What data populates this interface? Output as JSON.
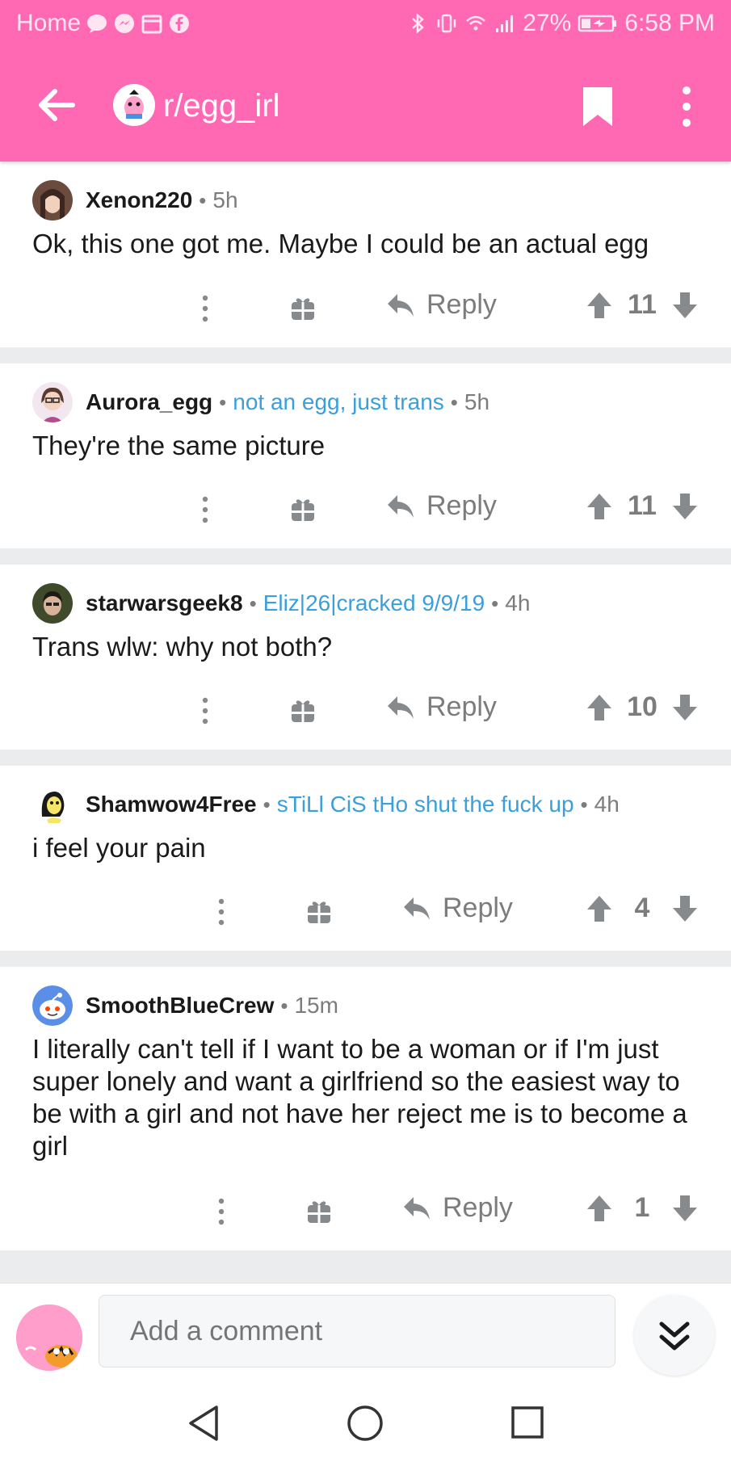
{
  "status_bar": {
    "left_label": "Home",
    "battery": "27%",
    "time": "6:58 PM"
  },
  "header": {
    "subreddit": "r/egg_irl",
    "accent_color": "#ff69b4"
  },
  "comments": [
    {
      "author": "Xenon220",
      "flair": "",
      "age": "5h",
      "body": "Ok, this one got me. Maybe I could be an actual egg",
      "reply_label": "Reply",
      "score": "11"
    },
    {
      "author": "Aurora_egg",
      "flair": "not an egg, just trans",
      "age": "5h",
      "body": "They're the same picture",
      "reply_label": "Reply",
      "score": "11"
    },
    {
      "author": "starwarsgeek8",
      "flair": "Eliz|26|cracked 9/9/19",
      "age": "4h",
      "body": "Trans wlw: why not both?",
      "reply_label": "Reply",
      "score": "10"
    },
    {
      "author": "Shamwow4Free",
      "flair": "sTiLl CiS tHo shut the fuck up",
      "age": "4h",
      "body": "i feel your pain",
      "reply_label": "Reply",
      "score": "4"
    },
    {
      "author": "SmoothBlueCrew",
      "flair": "",
      "age": "15m",
      "body": "I literally can't tell if I want to be a woman or if I'm just super lonely and want a girlfriend so the easiest way to be with a girl and not have her reject me is to become a girl",
      "reply_label": "Reply",
      "score": "1"
    }
  ],
  "composer": {
    "placeholder": "Add a comment"
  },
  "icons": {
    "back": "arrow-left-icon",
    "bookmark": "bookmark-icon",
    "more": "more-vertical-icon",
    "gift": "gift-icon",
    "reply": "reply-arrow-icon",
    "upvote": "upvote-arrow-icon",
    "downvote": "downvote-arrow-icon",
    "jump": "double-chevron-down-icon"
  }
}
